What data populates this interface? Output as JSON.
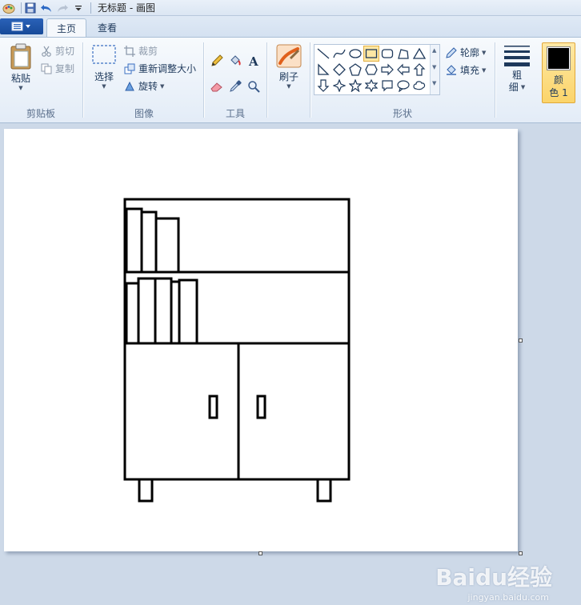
{
  "window": {
    "title": "无标题 - 画图"
  },
  "quick_access": {
    "icons": [
      "paint-app-icon",
      "save-icon",
      "undo-icon",
      "redo-icon",
      "customize-dropdown-icon"
    ]
  },
  "tabs": [
    {
      "label": "主页",
      "active": true
    },
    {
      "label": "查看",
      "active": false
    }
  ],
  "ribbon": {
    "clipboard": {
      "label": "剪贴板",
      "paste_label": "粘贴",
      "cut_label": "剪切",
      "copy_label": "复制"
    },
    "image": {
      "label": "图像",
      "select_label": "选择",
      "crop_label": "裁剪",
      "resize_label": "重新调整大小",
      "rotate_label": "旋转"
    },
    "tools": {
      "label": "工具"
    },
    "brushes": {
      "label": "刷子"
    },
    "shapes": {
      "label": "形状",
      "outline_label": "轮廓",
      "fill_label": "填充",
      "selected_shape": "rectangle"
    },
    "size": {
      "label_line1": "粗",
      "label_line2": "细"
    },
    "color1": {
      "label_line1": "颜",
      "label_line2": "色 1",
      "value": "#000000"
    }
  },
  "watermark": {
    "text": "Baidu经验",
    "sub": "jingyan.baidu.com"
  }
}
